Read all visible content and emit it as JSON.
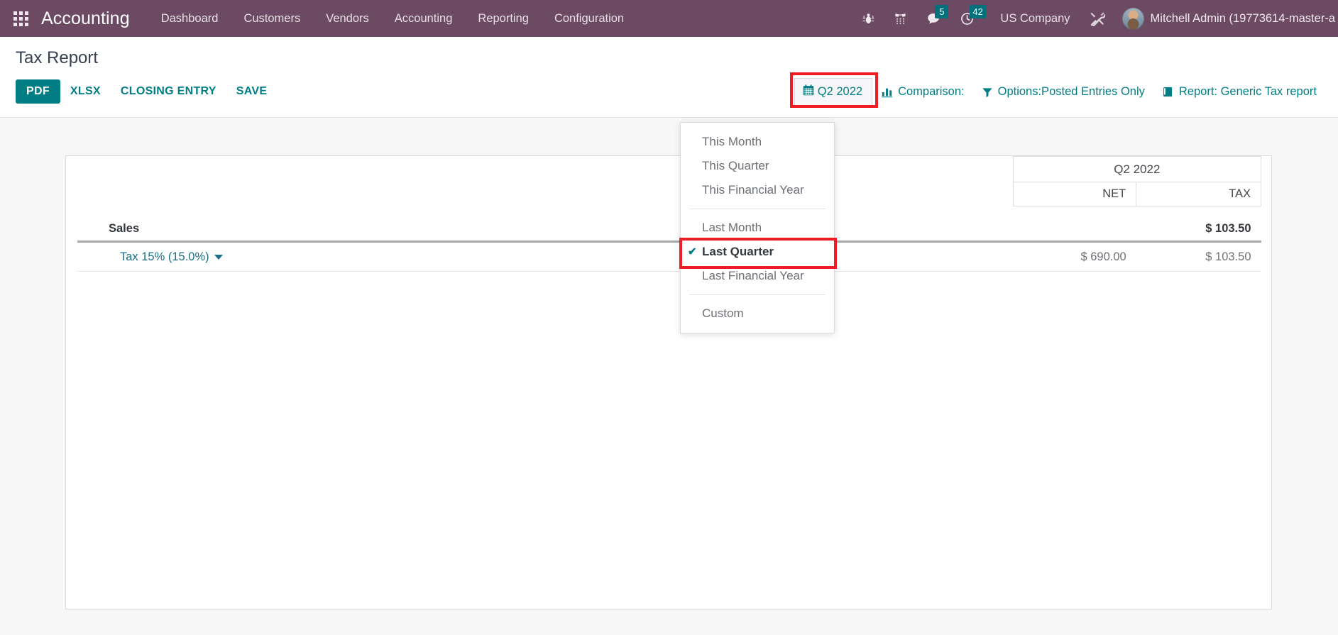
{
  "navbar": {
    "apps_icon": "apps-grid-icon",
    "brand": "Accounting",
    "menu": [
      {
        "label": "Dashboard"
      },
      {
        "label": "Customers"
      },
      {
        "label": "Vendors"
      },
      {
        "label": "Accounting"
      },
      {
        "label": "Reporting"
      },
      {
        "label": "Configuration"
      }
    ],
    "icons": [
      {
        "name": "bug-icon",
        "badge": null
      },
      {
        "name": "dialpad-icon",
        "badge": null
      },
      {
        "name": "messages-icon",
        "badge": "5"
      },
      {
        "name": "activity-clock-icon",
        "badge": "42"
      }
    ],
    "company": "US Company",
    "tools_icon": "tools-icon",
    "username": "Mitchell Admin (19773614-master-a",
    "avatar": "user-avatar"
  },
  "control_panel": {
    "title": "Tax Report",
    "buttons": [
      {
        "label": "PDF",
        "style": "primary"
      },
      {
        "label": "XLSX",
        "style": "link"
      },
      {
        "label": "CLOSING ENTRY",
        "style": "link"
      },
      {
        "label": "SAVE",
        "style": "link"
      }
    ],
    "filters": {
      "date": {
        "icon": "calendar-icon",
        "label": "Q2 2022",
        "open": true,
        "highlighted": true
      },
      "comparison": {
        "icon": "bar-chart-icon",
        "label": "Comparison:"
      },
      "options": {
        "icon": "funnel-icon",
        "label": "Options:Posted Entries Only"
      },
      "report": {
        "icon": "book-icon",
        "label": "Report: Generic Tax report"
      }
    }
  },
  "date_dropdown": {
    "groups": [
      {
        "items": [
          {
            "label": "This Month",
            "selected": false
          },
          {
            "label": "This Quarter",
            "selected": false
          },
          {
            "label": "This Financial Year",
            "selected": false
          }
        ]
      },
      {
        "items": [
          {
            "label": "Last Month",
            "selected": false
          },
          {
            "label": "Last Quarter",
            "selected": true
          },
          {
            "label": "Last Financial Year",
            "selected": false
          }
        ]
      },
      {
        "items": [
          {
            "label": "Custom",
            "selected": false
          }
        ]
      }
    ],
    "check_glyph": "✔"
  },
  "report": {
    "period_header": "Q2 2022",
    "columns": [
      "NET",
      "TAX"
    ],
    "rows": [
      {
        "type": "section",
        "name": "Sales",
        "net": "",
        "tax": "$ 103.50"
      },
      {
        "type": "line",
        "name": "Tax 15% (15.0%)",
        "net": "$ 690.00",
        "tax": "$ 103.50",
        "expandable": true
      }
    ]
  },
  "colors": {
    "brand_purple": "#6C4A63",
    "accent_teal": "#017E84",
    "link_teal": "#1A6E86",
    "annotation_red": "#EE1C24",
    "page_bg": "#F7F7F8"
  }
}
